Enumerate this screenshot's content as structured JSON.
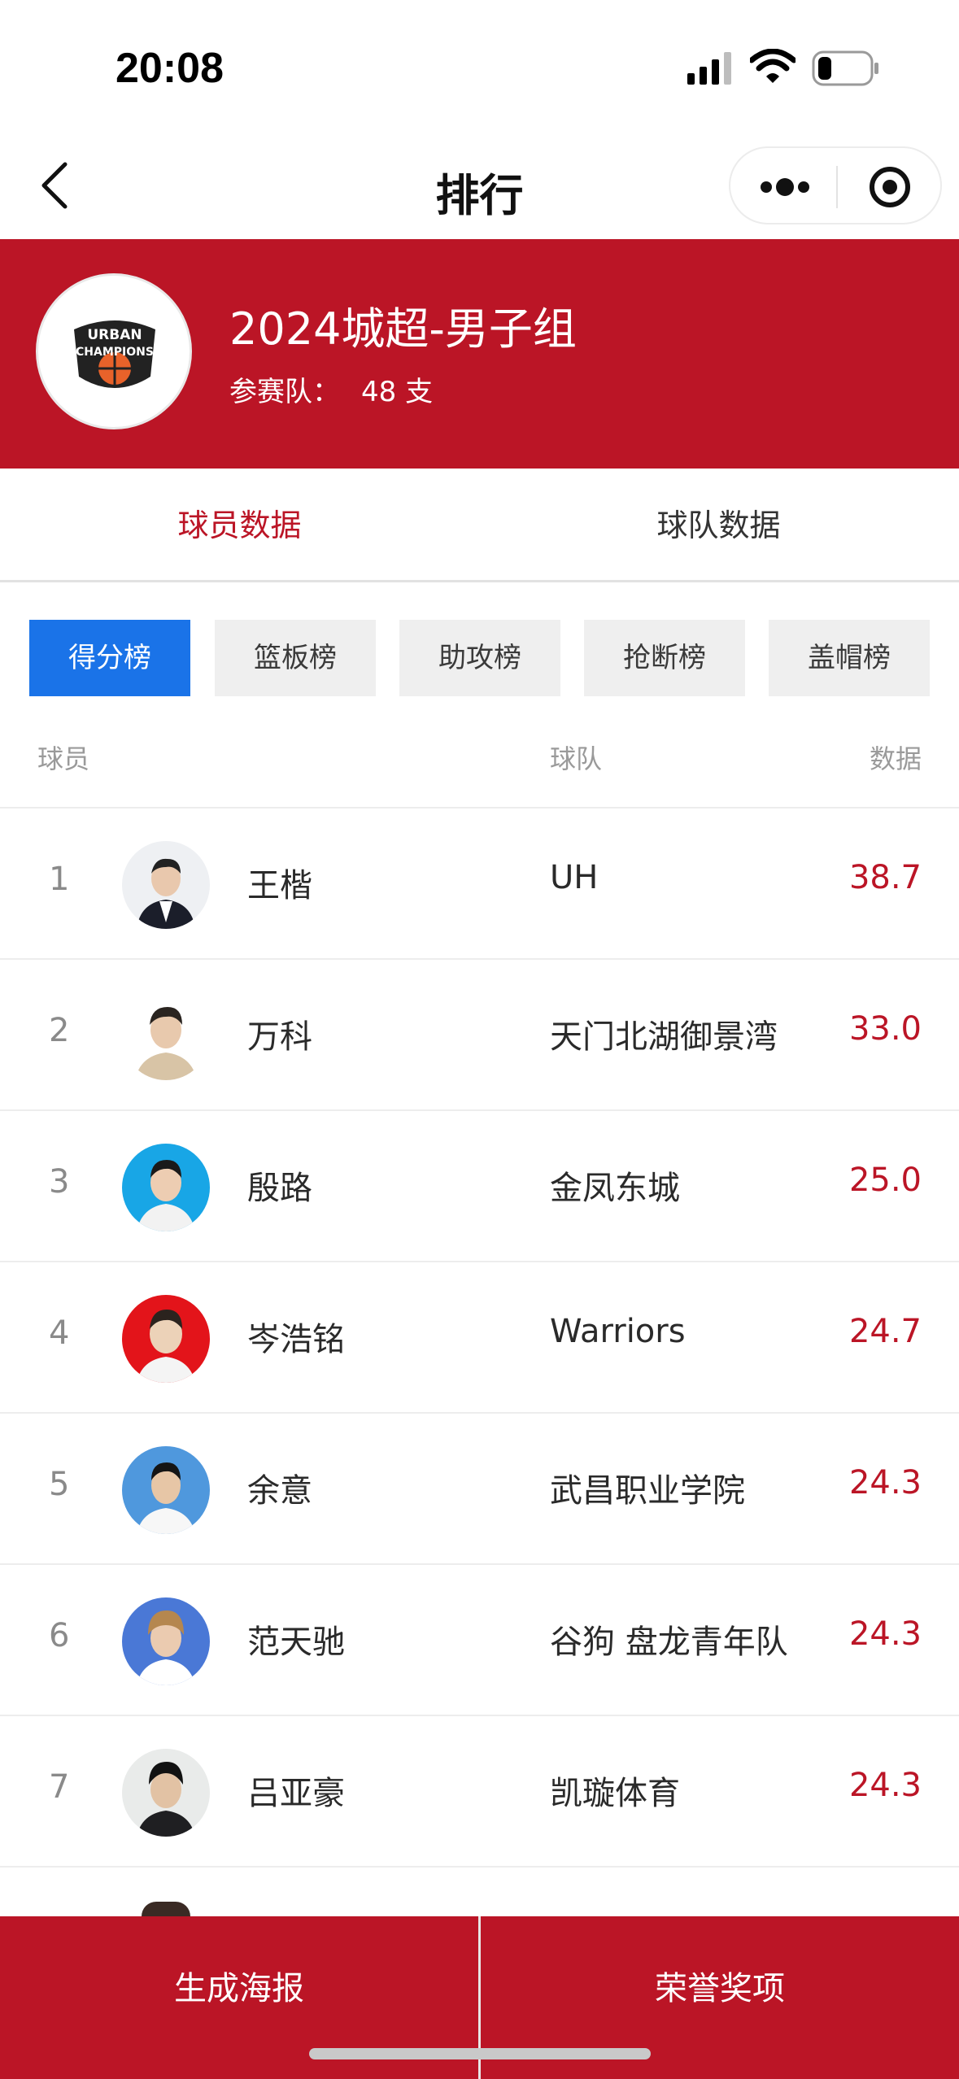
{
  "status_bar": {
    "time": "20:08",
    "icons": [
      "signal-icon",
      "wifi-icon",
      "battery-icon"
    ]
  },
  "nav": {
    "title": "排行",
    "back_icon": "chevron-left-icon",
    "more_icon": "more-dots-icon",
    "close_icon": "target-close-icon"
  },
  "league": {
    "name": "2024城超-男子组",
    "team_count_label": "参赛队：",
    "team_count_value": "48 支",
    "logo_text": [
      "URBAN",
      "CHAMPIONS"
    ]
  },
  "main_tabs": [
    {
      "label": "球员数据",
      "active": true
    },
    {
      "label": "球队数据",
      "active": false
    }
  ],
  "categories": [
    {
      "label": "得分榜",
      "active": true
    },
    {
      "label": "篮板榜",
      "active": false
    },
    {
      "label": "助攻榜",
      "active": false
    },
    {
      "label": "抢断榜",
      "active": false
    },
    {
      "label": "盖帽榜",
      "active": false
    }
  ],
  "columns": {
    "player": "球员",
    "team": "球队",
    "stat": "数据"
  },
  "rows": [
    {
      "rank": "1",
      "player": "王楷",
      "team": "UH",
      "value": "38.7"
    },
    {
      "rank": "2",
      "player": "万科",
      "team": "天门北湖御景湾",
      "value": "33.0"
    },
    {
      "rank": "3",
      "player": "殷路",
      "team": "金凤东城",
      "value": "25.0"
    },
    {
      "rank": "4",
      "player": "岑浩铭",
      "team": "Warriors",
      "value": "24.7"
    },
    {
      "rank": "5",
      "player": "余意",
      "team": "武昌职业学院",
      "value": "24.3"
    },
    {
      "rank": "6",
      "player": "范天驰",
      "team": "谷狗 盘龙青年队",
      "value": "24.3"
    },
    {
      "rank": "7",
      "player": "吕亚豪",
      "team": "凯璇体育",
      "value": "24.3"
    }
  ],
  "bottom_bar": {
    "left_label": "生成海报",
    "right_label": "荣誉奖项"
  },
  "colors": {
    "brand_red": "#bb1526",
    "chip_active_blue": "#1a73e8"
  }
}
